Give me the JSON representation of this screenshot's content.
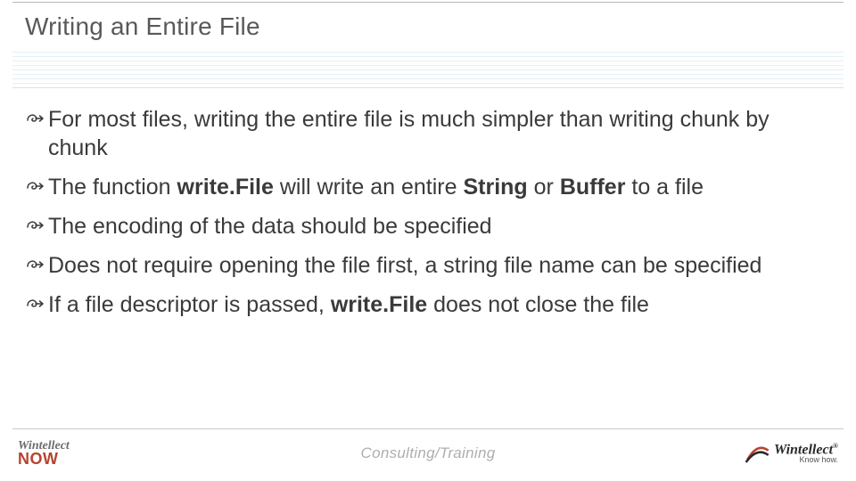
{
  "title": "Writing an Entire File",
  "bullets": [
    {
      "html": "For most files, writing the entire file is much simpler than writing chunk by chunk"
    },
    {
      "html": "The function <b>write.File</b> will write an entire <b>String</b> or <b>Buffer</b> to a file"
    },
    {
      "html": "The encoding of the data should be specified"
    },
    {
      "html": "Does not require opening the file first, a string file name can be specified"
    },
    {
      "html": "If a file descriptor is passed, <b>write.File</b> does not close the file"
    }
  ],
  "footer": {
    "center": "Consulting/Training",
    "left": {
      "line1": "Wintellect",
      "line2": "NOW"
    },
    "right": {
      "brand": "Wintellect",
      "reg": "®",
      "tagline": "Know how."
    }
  }
}
